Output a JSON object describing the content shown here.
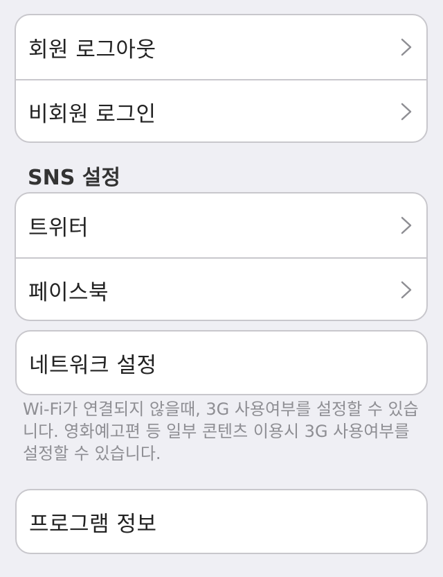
{
  "account_group": {
    "items": [
      {
        "label": "회원 로그아웃"
      },
      {
        "label": "비회원 로그인"
      }
    ]
  },
  "sns_section": {
    "header": "SNS 설정",
    "items": [
      {
        "label": "트위터"
      },
      {
        "label": "페이스북"
      }
    ]
  },
  "network_group": {
    "label": "네트워크 설정",
    "footnote": "Wi-Fi가 연결되지 않을때, 3G 사용여부를 설정할 수 있습니다. 영화예고편 등 일부 콘텐츠 이용시 3G 사용여부를 설정할 수 있습니다."
  },
  "program_group": {
    "label": "프로그램 정보"
  },
  "colors": {
    "background": "#efeff4",
    "cell": "#ffffff",
    "separator": "#c8c7cc",
    "chevron": "#8e8e93",
    "footnote": "#8e8e93"
  },
  "icons": {
    "disclosure": "chevron-right-icon"
  }
}
